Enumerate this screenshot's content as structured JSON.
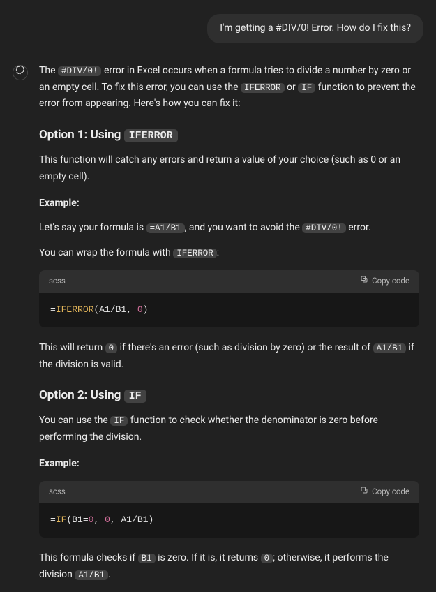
{
  "user_message": "I'm getting a #DIV/0! Error. How do I fix this?",
  "intro": {
    "p1_a": "The ",
    "p1_code1": "#DIV/0!",
    "p1_b": " error in Excel occurs when a formula tries to divide a number by zero or an empty cell. To fix this error, you can use the ",
    "p1_code2": "IFERROR",
    "p1_c": " or ",
    "p1_code3": "IF",
    "p1_d": " function to prevent the error from appearing. Here's how you can fix it:"
  },
  "option1": {
    "heading_text": "Option 1: Using ",
    "heading_code": "IFERROR",
    "desc": "This function will catch any errors and return a value of your choice (such as 0 or an empty cell).",
    "example_label": "Example:",
    "ex_a": "Let's say your formula is ",
    "ex_code1": "=A1/B1",
    "ex_b": ", and you want to avoid the ",
    "ex_code2": "#DIV/0!",
    "ex_c": " error.",
    "wrap_a": "You can wrap the formula with ",
    "wrap_code": "IFERROR",
    "wrap_b": ":",
    "code_lang": "scss",
    "copy_label": "Copy code",
    "code": {
      "eq": "=",
      "fn": "IFERROR",
      "open": "(",
      "arg1": "A1/B1",
      "comma": ", ",
      "arg2": "0",
      "close": ")"
    },
    "after_a": "This will return ",
    "after_code1": "0",
    "after_b": " if there's an error (such as division by zero) or the result of ",
    "after_code2": "A1/B1",
    "after_c": " if the division is valid."
  },
  "option2": {
    "heading_text": "Option 2: Using ",
    "heading_code": "IF",
    "desc_a": "You can use the ",
    "desc_code": "IF",
    "desc_b": " function to check whether the denominator is zero before performing the division.",
    "example_label": "Example:",
    "code_lang": "scss",
    "copy_label": "Copy code",
    "code": {
      "eq": "=",
      "fn": "IF",
      "open": "(",
      "cond_ref": "B1",
      "cond_eq": "=",
      "cond_val": "0",
      "c1": ", ",
      "then": "0",
      "c2": ", ",
      "else": "A1/B1",
      "close": ")"
    },
    "after_a": "This formula checks if ",
    "after_code1": "B1",
    "after_b": " is zero. If it is, it returns ",
    "after_code2": "0",
    "after_c": "; otherwise, it performs the division ",
    "after_code3": "A1/B1",
    "after_d": "."
  }
}
